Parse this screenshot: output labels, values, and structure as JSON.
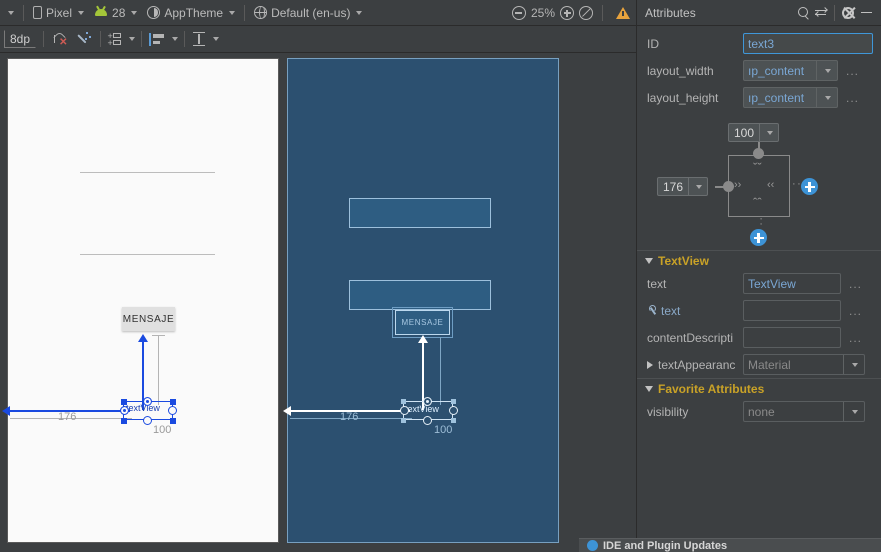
{
  "toolbar": {
    "left_caret_label": "",
    "device": {
      "label": "Pixel",
      "icon": "phone-icon"
    },
    "api": {
      "label": "28",
      "icon": "android-icon"
    },
    "theme": {
      "label": "AppTheme",
      "icon": "theme-icon"
    },
    "locale": {
      "label": "Default (en-us)",
      "icon": "globe-icon"
    },
    "zoom_out": "zoom-out-icon",
    "zoom_level": "25%",
    "zoom_in": "zoom-in-icon",
    "zoom_fit": "zoom-fit-icon",
    "warning": "warning-icon"
  },
  "toolbar2": {
    "default_margin": "8dp",
    "clear_constraints": "clear-constraints-icon",
    "infer_constraints": "infer-constraints-icon",
    "guidelines": "guidelines-icon",
    "align": "align-icon",
    "distribute": "distribute-icon"
  },
  "canvas": {
    "design": {
      "button_label": "MENSAJE",
      "selected_widget_label": "textView",
      "margin_top": "100",
      "margin_start": "176"
    },
    "blueprint": {
      "button_label": "MENSAJE",
      "selected_widget_label": "textView",
      "margin_top": "100",
      "margin_start": "176"
    }
  },
  "attributes": {
    "title": "Attributes",
    "icons": {
      "search": "search-icon",
      "sort": "swap-arrows-icon",
      "settings": "gear-icon",
      "minimize": "minimize-icon"
    },
    "id": {
      "label": "ID",
      "value": "text3"
    },
    "layout_width": {
      "label": "layout_width",
      "value": "ıp_content",
      "more": "..."
    },
    "layout_height": {
      "label": "layout_height",
      "value": "ıp_content",
      "more": "..."
    },
    "constraint_widget": {
      "top_margin": "100",
      "start_margin": "176",
      "chevron_left": "››",
      "chevron_right": "‹‹",
      "chevron_down": "ˇˇ",
      "chevron_up": "ˆˆ",
      "add_right": "add-constraint-icon",
      "add_bottom": "add-constraint-icon"
    },
    "textview_section": {
      "title": "TextView",
      "rows": [
        {
          "label": "text",
          "value": "TextView",
          "more": "...",
          "icon": null
        },
        {
          "label": "text",
          "value": "",
          "more": "...",
          "icon": "wrench-icon"
        },
        {
          "label": "contentDescripti",
          "value": "",
          "more": "...",
          "icon": null
        }
      ],
      "text_appearance": {
        "label": "textAppearanc",
        "value": "Material"
      }
    },
    "favorite_section": {
      "title": "Favorite Attributes",
      "rows": [
        {
          "label": "visibility",
          "value": "none"
        }
      ]
    }
  },
  "notification": {
    "text": "IDE and Plugin Updates",
    "icon": "info-icon"
  },
  "colors": {
    "panel_bg": "#3c3f41",
    "accent_blue": "#3d93d6",
    "section_gold": "#c9a227",
    "blueprint_bg": "#2c5070",
    "constraint_blue": "#1a4ae0",
    "warning_orange": "#e8a33d"
  }
}
